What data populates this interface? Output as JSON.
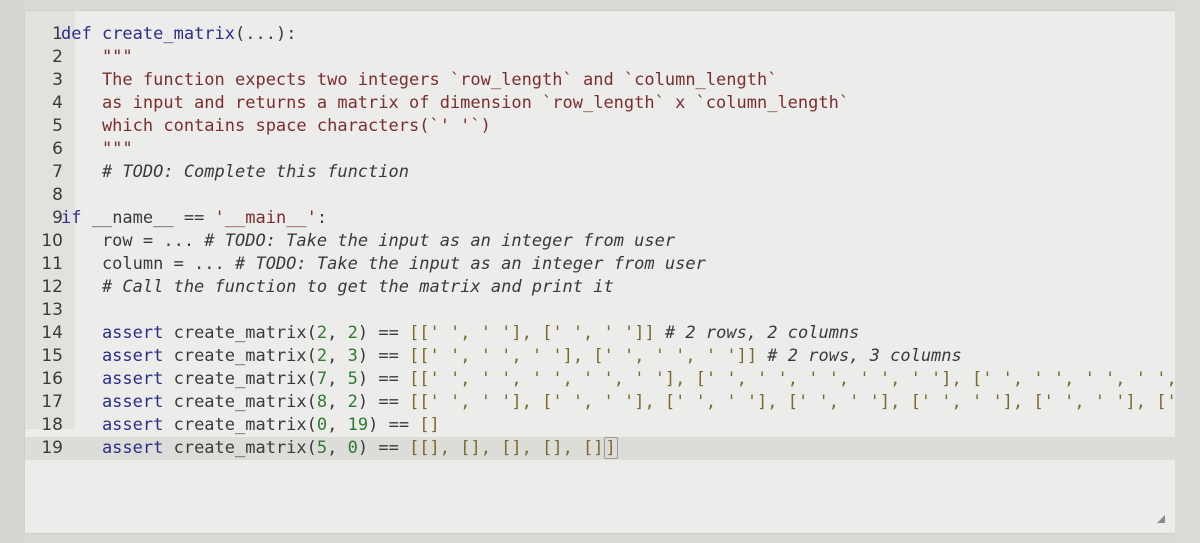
{
  "editor": {
    "lines": [
      {
        "n": "1",
        "tokens": [
          {
            "t": "def ",
            "c": "kw"
          },
          {
            "t": "create_matrix",
            "c": "fn"
          },
          {
            "t": "(...):",
            "c": "plain"
          }
        ]
      },
      {
        "n": "2",
        "tokens": [
          {
            "t": "    \"\"\"",
            "c": "doc"
          }
        ]
      },
      {
        "n": "3",
        "tokens": [
          {
            "t": "    The function expects two integers `row_length` and `column_length`",
            "c": "doc"
          }
        ]
      },
      {
        "n": "4",
        "tokens": [
          {
            "t": "    as input and returns a matrix of dimension `row_length` x `column_length`",
            "c": "doc"
          }
        ]
      },
      {
        "n": "5",
        "tokens": [
          {
            "t": "    which contains space characters(`' '`)",
            "c": "doc"
          }
        ]
      },
      {
        "n": "6",
        "tokens": [
          {
            "t": "    \"\"\"",
            "c": "doc"
          }
        ]
      },
      {
        "n": "7",
        "tokens": [
          {
            "t": "    # TODO: Complete this function",
            "c": "cmt"
          }
        ]
      },
      {
        "n": "8",
        "tokens": []
      },
      {
        "n": "9",
        "tokens": [
          {
            "t": "if ",
            "c": "kw"
          },
          {
            "t": "__name__ == ",
            "c": "plain"
          },
          {
            "t": "'__main__'",
            "c": "str"
          },
          {
            "t": ":",
            "c": "plain"
          }
        ]
      },
      {
        "n": "10",
        "tokens": [
          {
            "t": "    row = ... ",
            "c": "plain"
          },
          {
            "t": "# TODO: Take the input as an integer from user",
            "c": "cmt"
          }
        ]
      },
      {
        "n": "11",
        "tokens": [
          {
            "t": "    column = ... ",
            "c": "plain"
          },
          {
            "t": "# TODO: Take the input as an integer from user",
            "c": "cmt"
          }
        ]
      },
      {
        "n": "12",
        "tokens": [
          {
            "t": "    # Call the function to get the matrix and print it",
            "c": "cmt"
          }
        ]
      },
      {
        "n": "13",
        "tokens": []
      },
      {
        "n": "14",
        "tokens": [
          {
            "t": "    assert ",
            "c": "kw"
          },
          {
            "t": "create_matrix(",
            "c": "plain"
          },
          {
            "t": "2",
            "c": "num"
          },
          {
            "t": ", ",
            "c": "plain"
          },
          {
            "t": "2",
            "c": "num"
          },
          {
            "t": ") == ",
            "c": "plain"
          },
          {
            "t": "[[' ', ' '], [' ', ' ']]",
            "c": "brk"
          },
          {
            "t": " # 2 rows, 2 columns",
            "c": "cmt"
          }
        ]
      },
      {
        "n": "15",
        "tokens": [
          {
            "t": "    assert ",
            "c": "kw"
          },
          {
            "t": "create_matrix(",
            "c": "plain"
          },
          {
            "t": "2",
            "c": "num"
          },
          {
            "t": ", ",
            "c": "plain"
          },
          {
            "t": "3",
            "c": "num"
          },
          {
            "t": ") == ",
            "c": "plain"
          },
          {
            "t": "[[' ', ' ', ' '], [' ', ' ', ' ']]",
            "c": "brk"
          },
          {
            "t": " # 2 rows, 3 columns",
            "c": "cmt"
          }
        ]
      },
      {
        "n": "16",
        "tokens": [
          {
            "t": "    assert ",
            "c": "kw"
          },
          {
            "t": "create_matrix(",
            "c": "plain"
          },
          {
            "t": "7",
            "c": "num"
          },
          {
            "t": ", ",
            "c": "plain"
          },
          {
            "t": "5",
            "c": "num"
          },
          {
            "t": ") == ",
            "c": "plain"
          },
          {
            "t": "[[' ', ' ', ' ', ' ', ' '], [' ', ' ', ' ', ' ', ' '], [' ', ' ', ' ', ' ', '",
            "c": "brk"
          }
        ]
      },
      {
        "n": "17",
        "tokens": [
          {
            "t": "    assert ",
            "c": "kw"
          },
          {
            "t": "create_matrix(",
            "c": "plain"
          },
          {
            "t": "8",
            "c": "num"
          },
          {
            "t": ", ",
            "c": "plain"
          },
          {
            "t": "2",
            "c": "num"
          },
          {
            "t": ") == ",
            "c": "plain"
          },
          {
            "t": "[[' ', ' '], [' ', ' '], [' ', ' '], [' ', ' '], [' ', ' '], [' ', ' '], [' ', ' '],",
            "c": "brk"
          }
        ]
      },
      {
        "n": "18",
        "tokens": [
          {
            "t": "    assert ",
            "c": "kw"
          },
          {
            "t": "create_matrix(",
            "c": "plain"
          },
          {
            "t": "0",
            "c": "num"
          },
          {
            "t": ", ",
            "c": "plain"
          },
          {
            "t": "19",
            "c": "num"
          },
          {
            "t": ") == ",
            "c": "plain"
          },
          {
            "t": "[]",
            "c": "brk"
          }
        ]
      },
      {
        "n": "19",
        "active": true,
        "tokens": [
          {
            "t": "    assert ",
            "c": "kw"
          },
          {
            "t": "create_matrix(",
            "c": "plain"
          },
          {
            "t": "5",
            "c": "num"
          },
          {
            "t": ", ",
            "c": "plain"
          },
          {
            "t": "0",
            "c": "num"
          },
          {
            "t": ") == ",
            "c": "plain"
          },
          {
            "t": "[[], [], [], [], []",
            "c": "brk"
          },
          {
            "t": "]",
            "c": "brk",
            "cursor": true
          }
        ]
      }
    ]
  }
}
